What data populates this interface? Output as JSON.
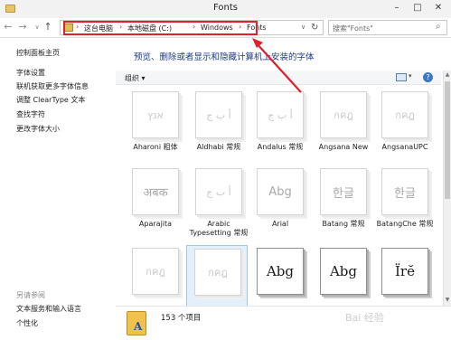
{
  "window": {
    "title": "Fonts",
    "minimize": "–",
    "maximize": "□",
    "close": "✕"
  },
  "nav": {
    "back": "←",
    "forward": "→",
    "history": "∨",
    "up": "↑"
  },
  "address": {
    "crumbs": [
      "这台电脑",
      "本地磁盘 (C:)",
      "Windows",
      "Fonts"
    ],
    "separator": "›",
    "dropdown": "∨",
    "refresh": "↻"
  },
  "search": {
    "placeholder": "搜索\"Fonts\"",
    "icon": "⌕"
  },
  "left_panel": {
    "items": [
      "控制面板主页",
      "字体设置",
      "联机获取更多字体信息",
      "调整 ClearType 文本",
      "查找字符",
      "更改字体大小"
    ],
    "see_also_heading": "另请参阅",
    "see_also": [
      "文本服务和输入语言",
      "个性化"
    ]
  },
  "main": {
    "banner": "预览、删除或者显示和隐藏计算机上安装的字体",
    "toolbar": {
      "organize": "组织 ▾",
      "view_dropdown": "▾",
      "help": "?"
    },
    "tiles": [
      {
        "label": "Aharoni 粗体",
        "sample": "אנץ"
      },
      {
        "label": "Aldhabi 常规",
        "sample": "أ ب ج"
      },
      {
        "label": "Andalus 常规",
        "sample": "أ ب ج"
      },
      {
        "label": "Angsana New",
        "sample": "กคฎ"
      },
      {
        "label": "AngsanaUPC",
        "sample": "กคฎ"
      },
      {
        "label": "Aparajita",
        "sample": "अबक"
      },
      {
        "label": "Arabic Typesetting 常规",
        "sample": "أ ب ج"
      },
      {
        "label": "Arial",
        "sample": "Abg"
      },
      {
        "label": "Batang 常规",
        "sample": "한글"
      },
      {
        "label": "BatangChe 常规",
        "sample": "한글"
      },
      {
        "label": "",
        "sample": "กคฎ"
      },
      {
        "label": "",
        "sample": "กคฎ"
      },
      {
        "label": "",
        "sample": "Abg"
      },
      {
        "label": "",
        "sample": "Abg"
      },
      {
        "label": "",
        "sample": "Ïrĕ"
      }
    ],
    "status": "153 个项目"
  },
  "scrollbar": {
    "up": "▲",
    "down": "▼"
  },
  "watermark": "Bai 经验"
}
